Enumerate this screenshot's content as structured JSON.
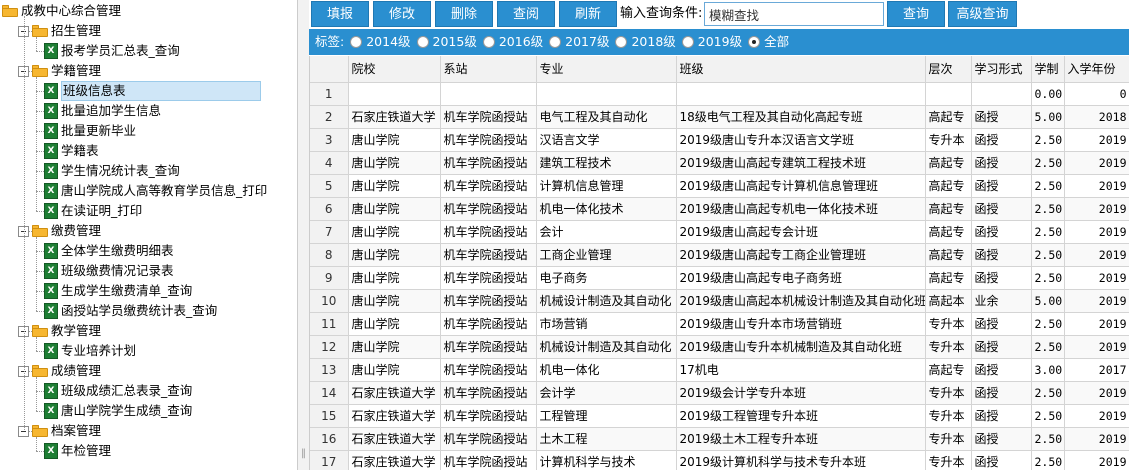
{
  "tree": {
    "root": "成教中心综合管理",
    "groups": [
      {
        "label": "招生管理",
        "items": [
          "报考学员汇总表_查询"
        ]
      },
      {
        "label": "学籍管理",
        "items": [
          "班级信息表",
          "批量追加学生信息",
          "批量更新毕业",
          "学籍表",
          "学生情况统计表_查询",
          "唐山学院成人高等教育学员信息_打印",
          "在读证明_打印"
        ]
      },
      {
        "label": "缴费管理",
        "items": [
          "全体学生缴费明细表",
          "班级缴费情况记录表",
          "生成学生缴费清单_查询",
          "函授站学员缴费统计表_查询"
        ]
      },
      {
        "label": "教学管理",
        "items": [
          "专业培养计划"
        ]
      },
      {
        "label": "成绩管理",
        "items": [
          "班级成绩汇总表录_查询",
          "唐山学院学生成绩_查询"
        ]
      },
      {
        "label": "档案管理",
        "items": [
          "年检管理"
        ]
      }
    ],
    "selected": "班级信息表",
    "file_icon_text": "X"
  },
  "toolbar": {
    "add": "填报",
    "edit": "修改",
    "delete": "删除",
    "view": "查阅",
    "refresh": "刷新",
    "query_label": "输入查询条件:",
    "query_value": "模糊查找",
    "query_button": "查询",
    "advanced_button": "高级查询"
  },
  "filter": {
    "label": "标签:",
    "options": [
      "2014级",
      "2015级",
      "2016级",
      "2017级",
      "2018级",
      "2019级",
      "全部"
    ],
    "selected": "全部"
  },
  "grid": {
    "columns": [
      "",
      "院校",
      "系站",
      "专业",
      "班级",
      "层次",
      "学习形式",
      "学制",
      "入学年份"
    ],
    "rows": [
      [
        "1",
        "",
        "",
        "",
        "",
        "",
        "",
        "0.00",
        "0"
      ],
      [
        "2",
        "石家庄铁道大学",
        "机车学院函授站",
        "电气工程及其自动化",
        "18级电气工程及其自动化高起专班",
        "高起专",
        "函授",
        "5.00",
        "2018"
      ],
      [
        "3",
        "唐山学院",
        "机车学院函授站",
        "汉语言文学",
        "2019级唐山专升本汉语言文学班",
        "专升本",
        "函授",
        "2.50",
        "2019"
      ],
      [
        "4",
        "唐山学院",
        "机车学院函授站",
        "建筑工程技术",
        "2019级唐山高起专建筑工程技术班",
        "高起专",
        "函授",
        "2.50",
        "2019"
      ],
      [
        "5",
        "唐山学院",
        "机车学院函授站",
        "计算机信息管理",
        "2019级唐山高起专计算机信息管理班",
        "高起专",
        "函授",
        "2.50",
        "2019"
      ],
      [
        "6",
        "唐山学院",
        "机车学院函授站",
        "机电一体化技术",
        "2019级唐山高起专机电一体化技术班",
        "高起专",
        "函授",
        "2.50",
        "2019"
      ],
      [
        "7",
        "唐山学院",
        "机车学院函授站",
        "会计",
        "2019级唐山高起专会计班",
        "高起专",
        "函授",
        "2.50",
        "2019"
      ],
      [
        "8",
        "唐山学院",
        "机车学院函授站",
        "工商企业管理",
        "2019级唐山高起专工商企业管理班",
        "高起专",
        "函授",
        "2.50",
        "2019"
      ],
      [
        "9",
        "唐山学院",
        "机车学院函授站",
        "电子商务",
        "2019级唐山高起专电子商务班",
        "高起专",
        "函授",
        "2.50",
        "2019"
      ],
      [
        "10",
        "唐山学院",
        "机车学院函授站",
        "机械设计制造及其自动化",
        "2019级唐山高起本机械设计制造及其自动化班",
        "高起本",
        "业余",
        "5.00",
        "2019"
      ],
      [
        "11",
        "唐山学院",
        "机车学院函授站",
        "市场营销",
        "2019级唐山专升本市场营销班",
        "专升本",
        "函授",
        "2.50",
        "2019"
      ],
      [
        "12",
        "唐山学院",
        "机车学院函授站",
        "机械设计制造及其自动化",
        "2019级唐山专升本机械制造及其自动化班",
        "专升本",
        "函授",
        "2.50",
        "2019"
      ],
      [
        "13",
        "唐山学院",
        "机车学院函授站",
        "机电一体化",
        "17机电",
        "高起专",
        "函授",
        "3.00",
        "2017"
      ],
      [
        "14",
        "石家庄铁道大学",
        "机车学院函授站",
        "会计学",
        "2019级会计学专升本班",
        "专升本",
        "函授",
        "2.50",
        "2019"
      ],
      [
        "15",
        "石家庄铁道大学",
        "机车学院函授站",
        "工程管理",
        "2019级工程管理专升本班",
        "专升本",
        "函授",
        "2.50",
        "2019"
      ],
      [
        "16",
        "石家庄铁道大学",
        "机车学院函授站",
        "土木工程",
        "2019级土木工程专升本班",
        "专升本",
        "函授",
        "2.50",
        "2019"
      ],
      [
        "17",
        "石家庄铁道大学",
        "机车学院函授站",
        "计算机科学与技术",
        "2019级计算机科学与技术专升本班",
        "专升本",
        "函授",
        "2.50",
        "2019"
      ]
    ]
  },
  "colors": {
    "accent": "#2a8fd0",
    "folder": "#f7b731",
    "excel": "#1e7e34",
    "selection": "#cfe6f7"
  }
}
